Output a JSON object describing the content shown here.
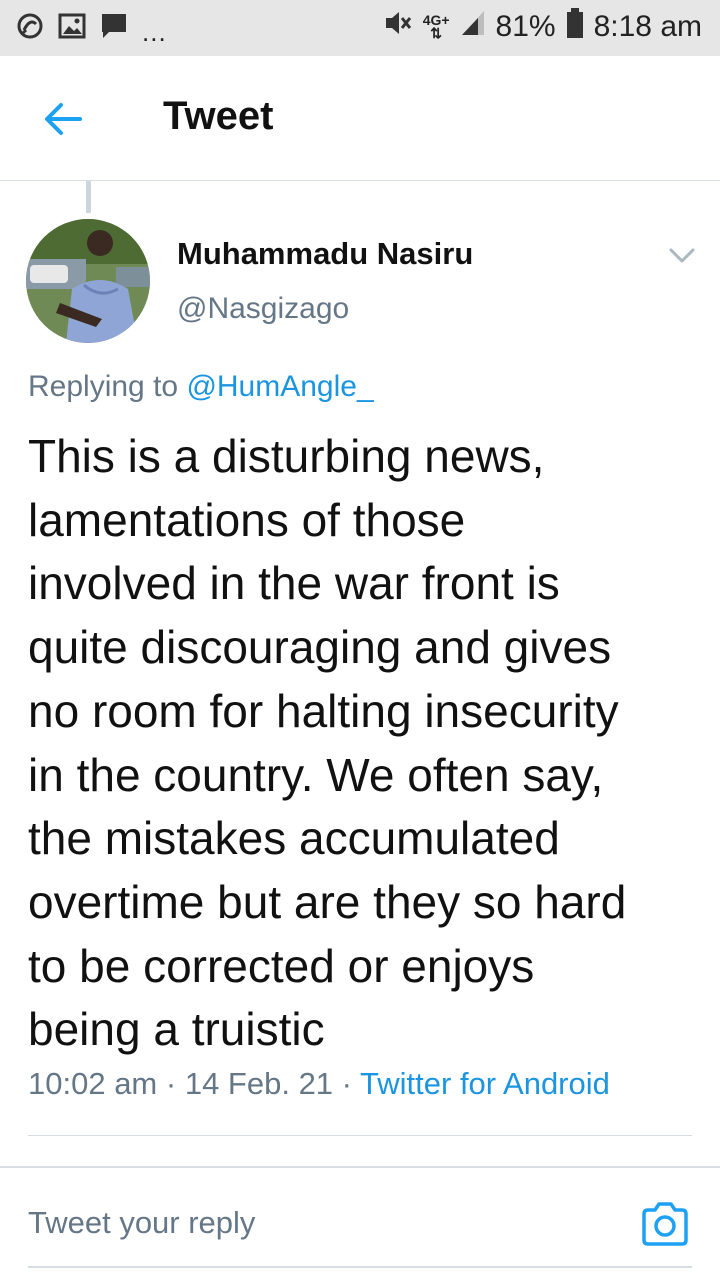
{
  "status_bar": {
    "battery": "81%",
    "time": "8:18 am",
    "network": "4G+",
    "more": "..."
  },
  "header": {
    "title": "Tweet"
  },
  "tweet": {
    "author_name": "Muhammadu Nasiru",
    "author_handle": "@Nasgizago",
    "replying_prefix": "Replying to ",
    "replying_to": "@HumAngle_",
    "text": "This is a disturbing news,\nlamentations of those\ninvolved in the war front is\nquite discouraging and gives\nno room for halting insecurity\nin the country. We often say,\nthe mistakes accumulated\novertime but are they so hard\nto be corrected or enjoys\nbeing a truistic",
    "time": "10:02 am",
    "separator": " · ",
    "date": "14 Feb. 21",
    "source": "Twitter for Android"
  },
  "reply": {
    "placeholder": "Tweet your reply"
  },
  "colors": {
    "accent": "#1b95e0",
    "secondary_text": "#657786",
    "divider": "#d7dde2",
    "status_bar_bg": "#e6e6e6"
  },
  "icons": [
    "signal-app-icon",
    "image-icon",
    "message-icon",
    "mute-icon",
    "signal-strength-icon",
    "battery-icon",
    "back-arrow-icon",
    "chevron-down-icon",
    "camera-icon"
  ]
}
